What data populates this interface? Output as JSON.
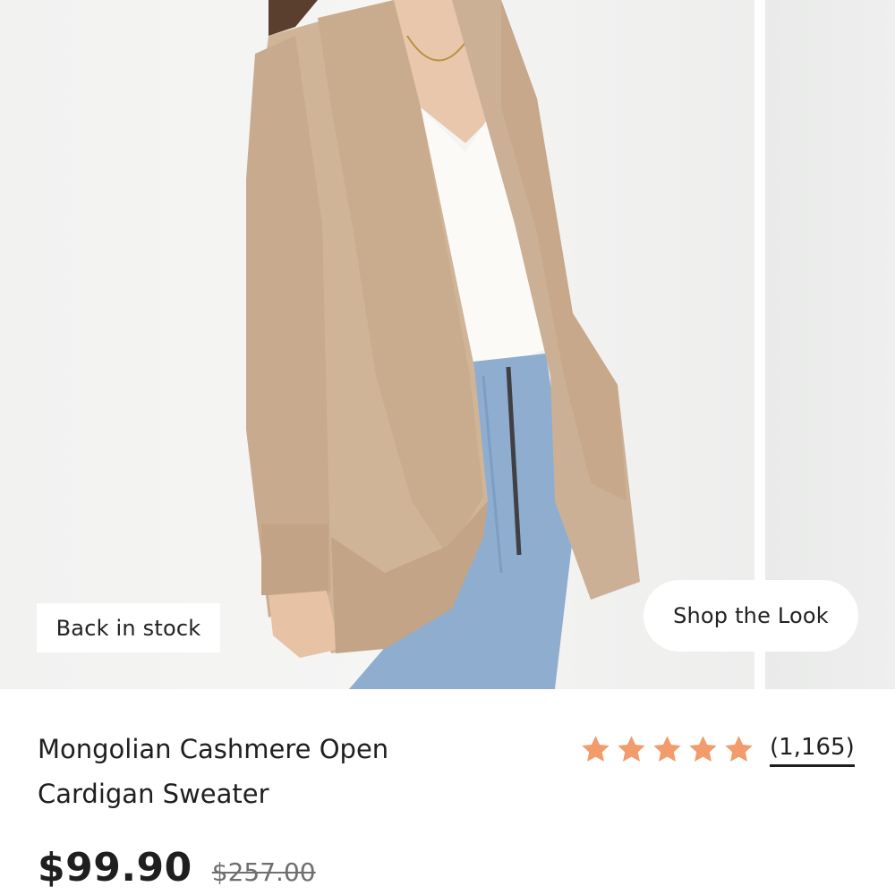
{
  "gallery": {
    "badge_label": "Back in stock",
    "shop_look_label": "Shop the Look"
  },
  "product": {
    "title_line1": "Mongolian Cashmere Open",
    "title_line2": "Cardigan Sweater",
    "rating": {
      "stars": 5,
      "review_count": "(1,165)",
      "star_color": "#f29b6b"
    },
    "price": {
      "sale": "$99.90",
      "original": "$257.00"
    }
  }
}
